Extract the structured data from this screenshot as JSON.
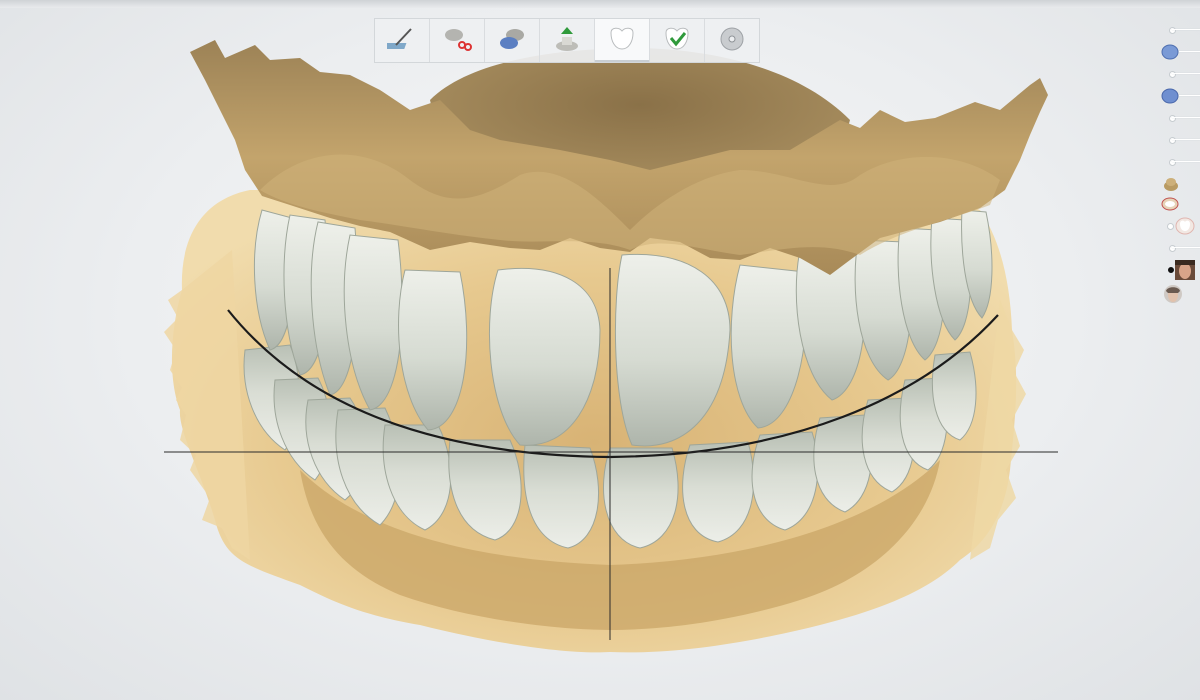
{
  "window": {
    "title": ""
  },
  "toolbar": {
    "tools": [
      {
        "icon": "scan-pen-icon"
      },
      {
        "icon": "scissors-icon"
      },
      {
        "icon": "model-align-icon"
      },
      {
        "icon": "model-insert-icon"
      },
      {
        "icon": "tooth-design-icon",
        "active": true
      },
      {
        "icon": "tooth-check-icon"
      },
      {
        "icon": "disc-export-icon"
      }
    ]
  },
  "right_panel": {
    "items": [
      {
        "icon": "slider-line-icon"
      },
      {
        "icon": "upper-jaw-blue-icon"
      },
      {
        "icon": "slider-line-icon"
      },
      {
        "icon": "lower-jaw-blue-icon"
      },
      {
        "icon": "slider-line-icon"
      },
      {
        "icon": "slider-line-icon"
      },
      {
        "icon": "slider-line-icon"
      },
      {
        "icon": "slider-line-icon"
      },
      {
        "icon": "gold-model-icon"
      },
      {
        "icon": "teeth-arch-icon"
      },
      {
        "icon": "crown-icon"
      },
      {
        "icon": "slider-line-icon"
      },
      {
        "icon": "face-photo-icon"
      },
      {
        "icon": "face-thumb-icon"
      }
    ]
  },
  "colors": {
    "background": "#eceef0",
    "gingiva_gold": "#c6a76d",
    "model_tan": "#e3c388",
    "teeth": "#d8dcd4",
    "arch_line": "#1b1b1b"
  }
}
